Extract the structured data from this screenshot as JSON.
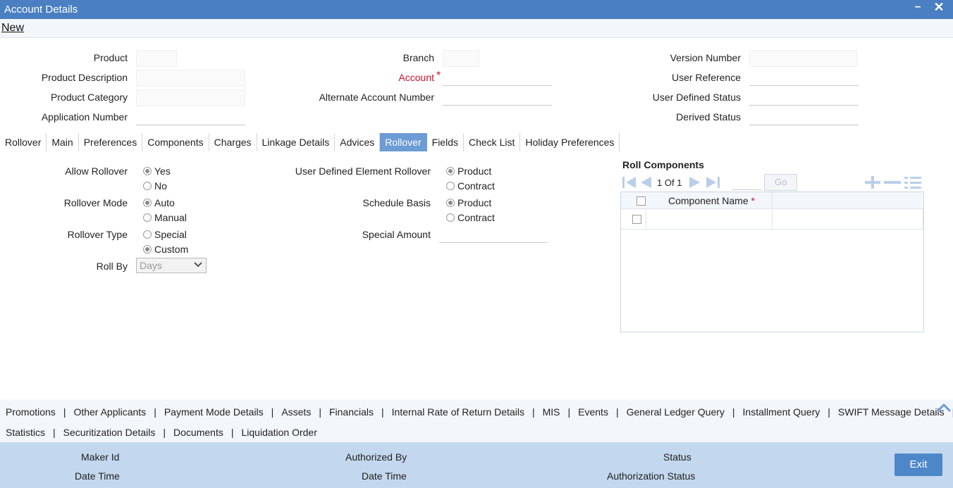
{
  "window": {
    "title": "Account Details",
    "minimize": "–",
    "close": "✕"
  },
  "menu": {
    "new_label": "New"
  },
  "header": {
    "product": "Product",
    "product_description": "Product Description",
    "product_category": "Product Category",
    "application_number": "Application Number",
    "branch": "Branch",
    "account": "Account",
    "account_required": "*",
    "alternate_account_number": "Alternate Account Number",
    "version_number": "Version Number",
    "user_reference": "User Reference",
    "user_defined_status": "User Defined Status",
    "derived_status": "Derived Status"
  },
  "tabs": [
    {
      "label": "Rollover",
      "active": false
    },
    {
      "label": "Main",
      "active": false
    },
    {
      "label": "Preferences",
      "active": false
    },
    {
      "label": "Components",
      "active": false
    },
    {
      "label": "Charges",
      "active": false
    },
    {
      "label": "Linkage Details",
      "active": false
    },
    {
      "label": "Advices",
      "active": false
    },
    {
      "label": "Rollover",
      "active": true
    },
    {
      "label": "Fields",
      "active": false
    },
    {
      "label": "Check List",
      "active": false
    },
    {
      "label": "Holiday Preferences",
      "active": false
    }
  ],
  "rollover": {
    "allow_rollover": {
      "label": "Allow Rollover",
      "opt1": "Yes",
      "opt2": "No",
      "selected": "Yes"
    },
    "rollover_mode": {
      "label": "Rollover Mode",
      "opt1": "Auto",
      "opt2": "Manual",
      "selected": "Auto"
    },
    "rollover_type": {
      "label": "Rollover Type",
      "opt1": "Special",
      "opt2": "Custom",
      "selected": "Custom"
    },
    "roll_by": {
      "label": "Roll By",
      "value": "Days"
    },
    "user_defined_element_rollover": {
      "label": "User Defined Element Rollover",
      "opt1": "Product",
      "opt2": "Contract",
      "selected": "Product"
    },
    "schedule_basis": {
      "label": "Schedule Basis",
      "opt1": "Product",
      "opt2": "Contract",
      "selected": "Product"
    },
    "special_amount": {
      "label": "Special Amount",
      "value": ""
    }
  },
  "roll_components": {
    "title": "Roll Components",
    "page_current": "1",
    "page_of": "Of",
    "page_total": "1",
    "go_label": "Go",
    "column_component_name": "Component Name",
    "required_mark": "*"
  },
  "bottom_links": {
    "line1": [
      "Promotions",
      "Other Applicants",
      "Payment Mode Details",
      "Assets",
      "Financials",
      "Internal Rate of Return Details",
      "MIS",
      "Events",
      "General Ledger Query",
      "Installment Query",
      "SWIFT Message Details"
    ],
    "line2": [
      "Statistics",
      "Securitization Details",
      "Documents",
      "Liquidation Order"
    ],
    "separator": "|"
  },
  "footer": {
    "maker_id": "Maker Id",
    "date_time_1": "Date Time",
    "authorized_by": "Authorized By",
    "date_time_2": "Date Time",
    "status": "Status",
    "authorization_status": "Authorization Status",
    "exit_label": "Exit"
  }
}
